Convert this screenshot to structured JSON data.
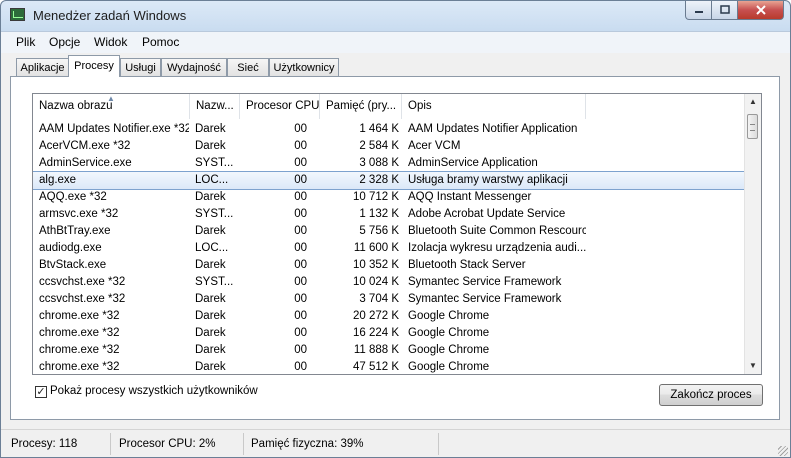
{
  "window": {
    "title": "Menedżer zadań Windows"
  },
  "menu": [
    "Plik",
    "Opcje",
    "Widok",
    "Pomoc"
  ],
  "tabs": [
    "Aplikacje",
    "Procesy",
    "Usługi",
    "Wydajność",
    "Sieć",
    "Użytkownicy"
  ],
  "active_tab": "Procesy",
  "table": {
    "columns": [
      "Nazwa obrazu",
      "Nazw...",
      "Procesor CPU",
      "Pamięć (pry...",
      "Opis"
    ],
    "sort_column": "Nazwa obrazu",
    "selected_row": 3,
    "rows": [
      [
        "AAM Updates Notifier.exe *32",
        "Darek",
        "00",
        "1 464 K",
        "AAM Updates Notifier Application"
      ],
      [
        "AcerVCM.exe *32",
        "Darek",
        "00",
        "2 584 K",
        "Acer VCM"
      ],
      [
        "AdminService.exe",
        "SYST...",
        "00",
        "3 088 K",
        "AdminService Application"
      ],
      [
        "alg.exe",
        "LOC...",
        "00",
        "2 328 K",
        "Usługa bramy warstwy aplikacji"
      ],
      [
        "AQQ.exe *32",
        "Darek",
        "00",
        "10 712 K",
        "AQQ Instant Messenger"
      ],
      [
        "armsvc.exe *32",
        "SYST...",
        "00",
        "1 132 K",
        "Adobe Acrobat Update Service"
      ],
      [
        "AthBtTray.exe",
        "Darek",
        "00",
        "5 756 K",
        "Bluetooth Suite Common Rescource"
      ],
      [
        "audiodg.exe",
        "LOC...",
        "00",
        "11 600 K",
        "Izolacja wykresu urządzenia audi..."
      ],
      [
        "BtvStack.exe",
        "Darek",
        "00",
        "10 352 K",
        "Bluetooth Stack Server"
      ],
      [
        "ccsvchst.exe *32",
        "SYST...",
        "00",
        "10 024 K",
        "Symantec Service Framework"
      ],
      [
        "ccsvchst.exe *32",
        "Darek",
        "00",
        "3 704 K",
        "Symantec Service Framework"
      ],
      [
        "chrome.exe *32",
        "Darek",
        "00",
        "20 272 K",
        "Google Chrome"
      ],
      [
        "chrome.exe *32",
        "Darek",
        "00",
        "16 224 K",
        "Google Chrome"
      ],
      [
        "chrome.exe *32",
        "Darek",
        "00",
        "11 888 K",
        "Google Chrome"
      ],
      [
        "chrome.exe *32",
        "Darek",
        "00",
        "47 512 K",
        "Google Chrome"
      ]
    ]
  },
  "show_all_users": {
    "label": "Pokaż procesy wszystkich użytkowników",
    "checked": true
  },
  "end_process_button": "Zakończ proces",
  "status": {
    "processes": "Procesy: 118",
    "cpu": "Procesor CPU: 2%",
    "memory": "Pamięć fizyczna: 39%"
  },
  "icons": {
    "app": "task-manager-icon",
    "minimize": "minimize-icon",
    "maximize": "maximize-icon",
    "close": "close-icon",
    "sort": "sort-ascending-icon",
    "scroll_up": "scroll-up-icon",
    "scroll_down": "scroll-down-icon",
    "grip": "resize-grip-icon"
  }
}
